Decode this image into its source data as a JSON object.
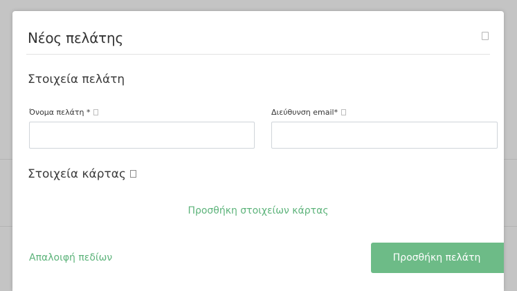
{
  "modal": {
    "title": "Νέος πελάτης",
    "close_icon": "close-icon"
  },
  "customer_section": {
    "title": "Στοιχεία πελάτη",
    "name_field": {
      "label": "Όνομα πελάτη *",
      "value": "",
      "placeholder": ""
    },
    "email_field": {
      "label": "Διεύθυνση email*",
      "value": "",
      "placeholder": ""
    }
  },
  "card_section": {
    "title": "Στοιχεία κάρτας",
    "add_card_link": "Προσθήκη στοιχείων κάρτας"
  },
  "footer": {
    "clear_link": "Απαλοιφή πεδίων",
    "add_button": "Προσθήκη πελάτη"
  },
  "colors": {
    "accent": "#5cb37a",
    "button": "#6dbb87",
    "overlay": "#c4c4c4"
  }
}
